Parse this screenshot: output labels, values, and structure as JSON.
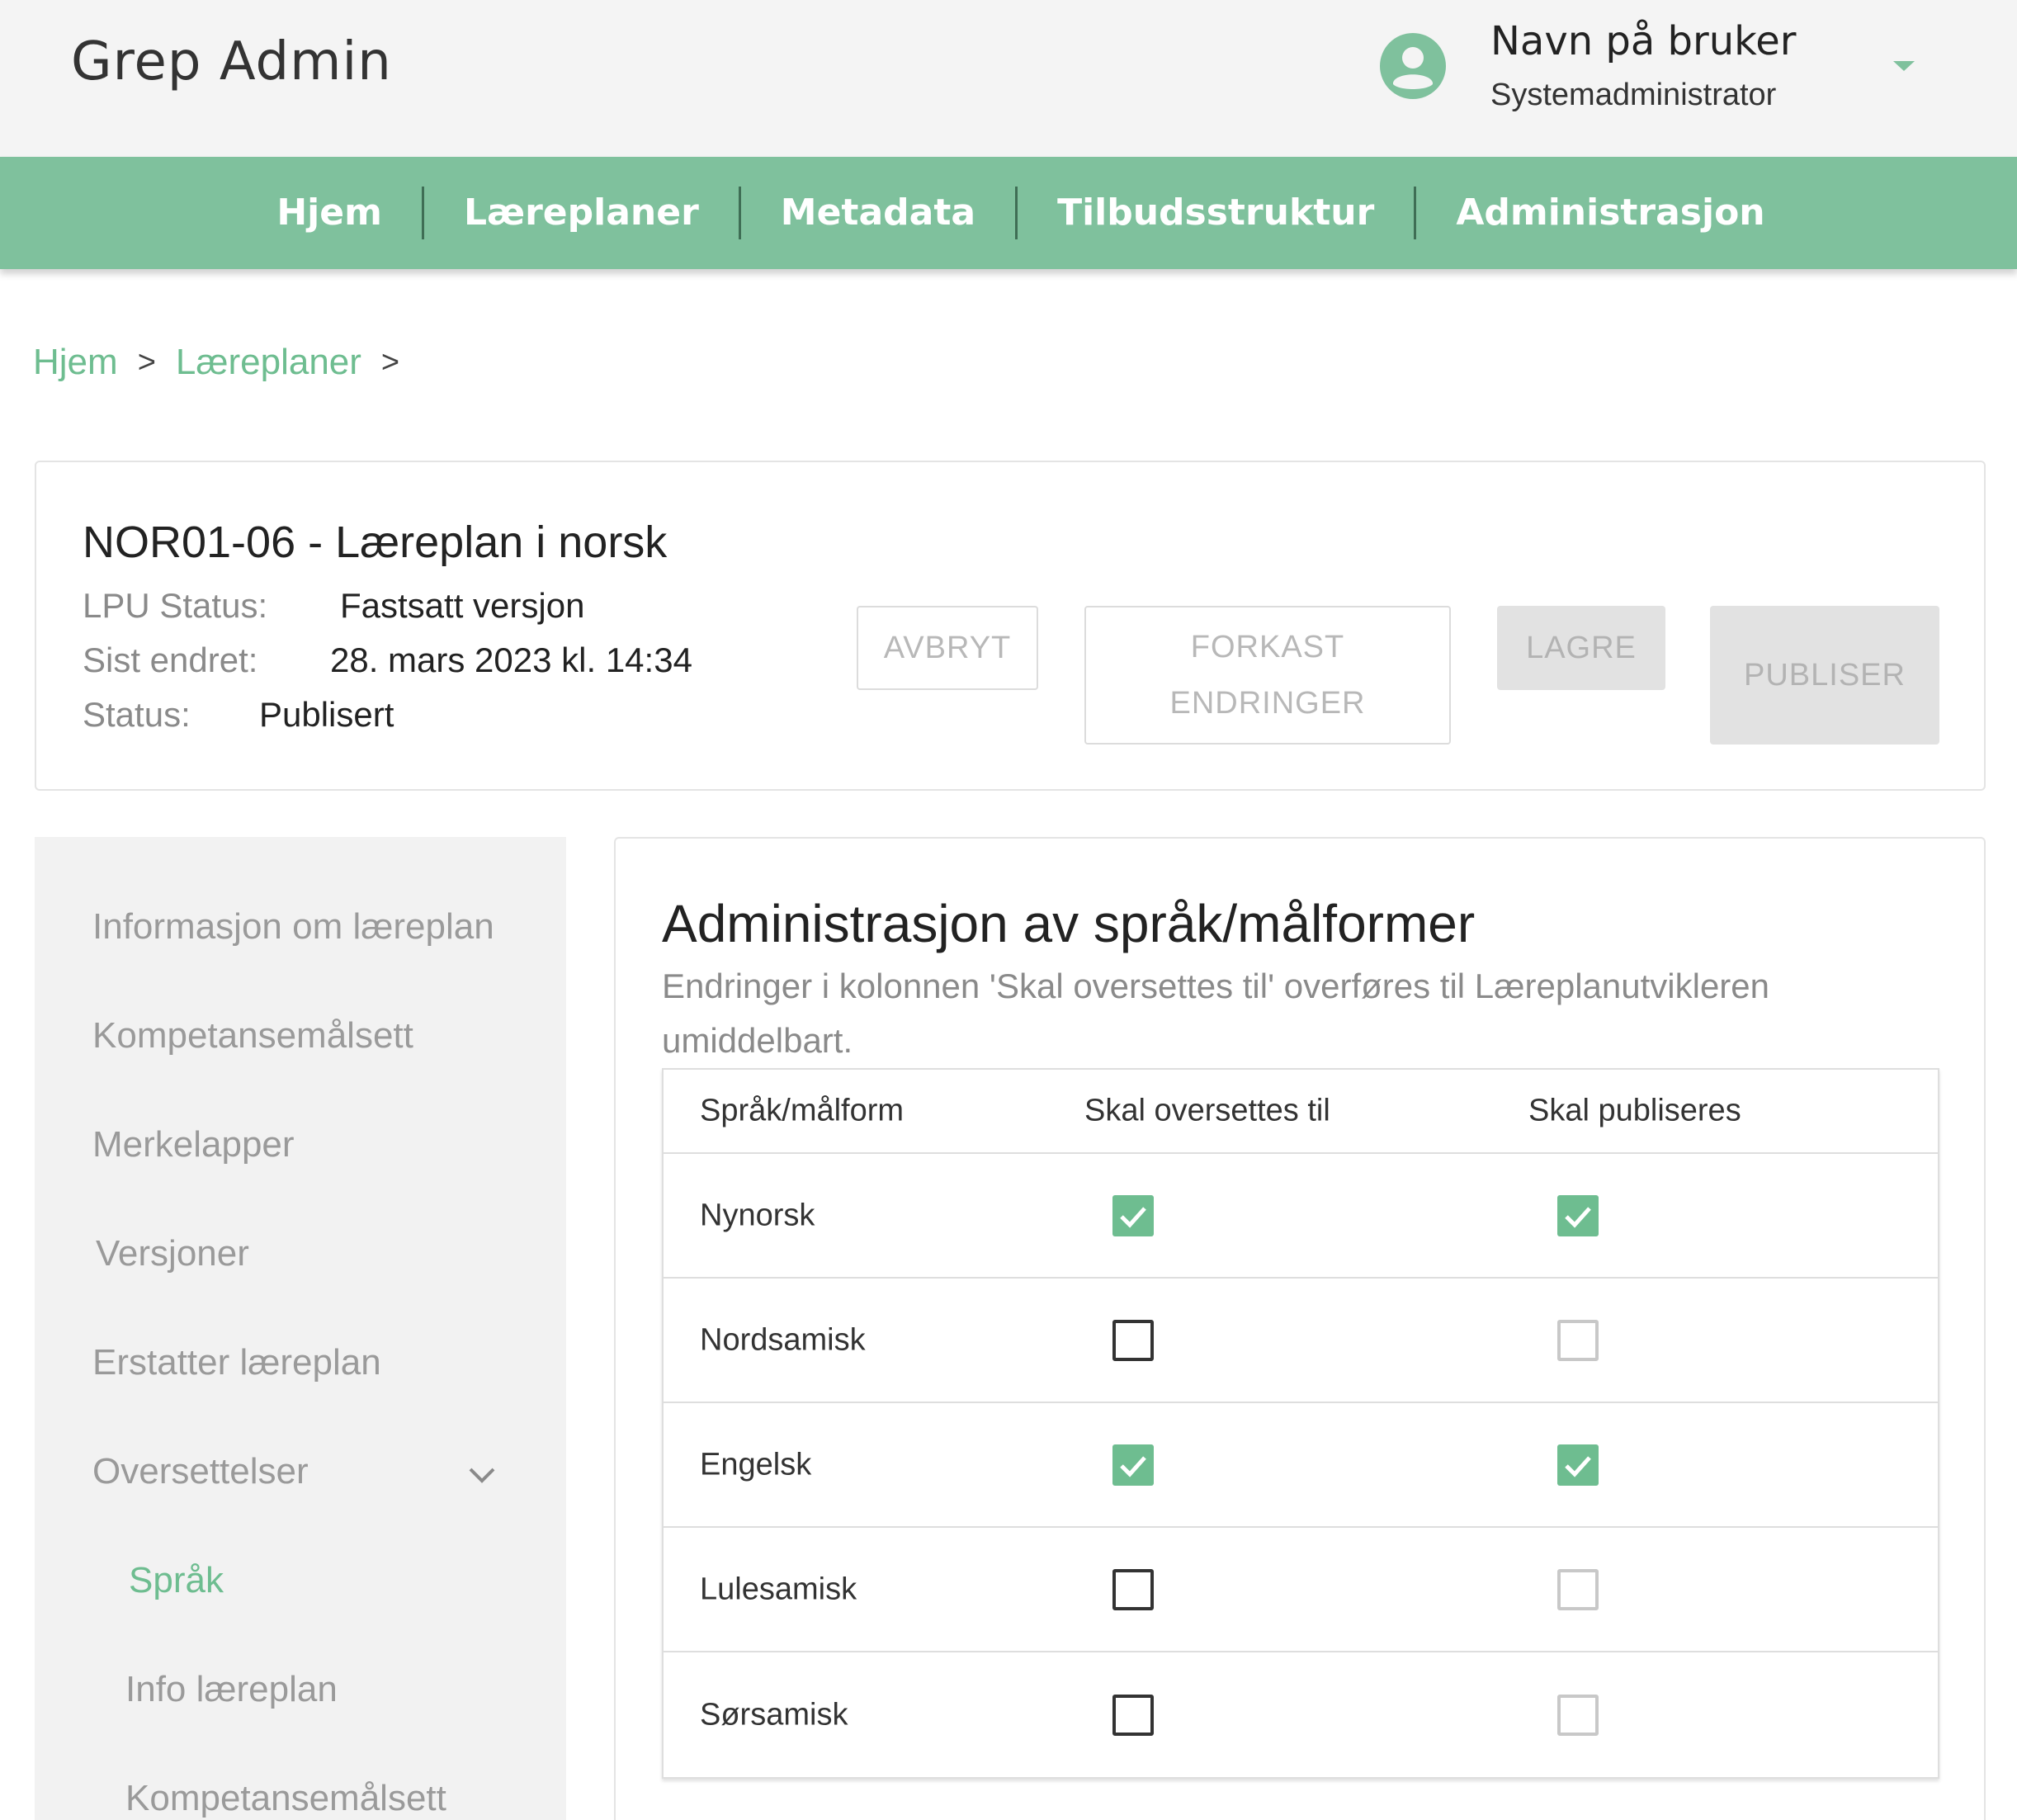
{
  "app": {
    "title": "Grep Admin"
  },
  "user": {
    "name": "Navn på bruker",
    "role": "Systemadministrator"
  },
  "nav": {
    "items": [
      "Hjem",
      "Læreplaner",
      "Metadata",
      "Tilbudsstruktur",
      "Administrasjon"
    ]
  },
  "breadcrumb": {
    "items": [
      "Hjem",
      "Læreplaner"
    ],
    "separator": ">"
  },
  "curriculum": {
    "title": "NOR01-06 - Læreplan i norsk",
    "lpu_status_label": "LPU Status:",
    "lpu_status_value": "Fastsatt versjon",
    "last_changed_label": "Sist endret:",
    "last_changed_value": "28. mars 2023 kl. 14:34",
    "status_label": "Status:",
    "status_value": "Publisert"
  },
  "actions": {
    "cancel": "AVBRYT",
    "discard_line1": "FORKAST",
    "discard_line2": "ENDRINGER",
    "save": "LAGRE",
    "publish": "PUBLISER"
  },
  "sidebar": {
    "items": [
      "Informasjon om læreplan",
      "Kompetansemålsett",
      "Merkelapper",
      "Versjoner",
      "Erstatter læreplan",
      "Oversettelser"
    ],
    "subitems": [
      "Språk",
      "Info læreplan",
      "Kompetansemålsett"
    ],
    "active": "Språk"
  },
  "panel": {
    "title": "Administrasjon av språk/målformer",
    "description": "Endringer i kolonnen 'Skal oversettes til' overføres til Læreplanutvikleren umiddelbart."
  },
  "table": {
    "headers": [
      "Språk/målform",
      "Skal oversettes til",
      "Skal publiseres"
    ],
    "rows": [
      {
        "language": "Nynorsk",
        "translate": true,
        "publish": true
      },
      {
        "language": "Nordsamisk",
        "translate": false,
        "publish": false
      },
      {
        "language": "Engelsk",
        "translate": true,
        "publish": true
      },
      {
        "language": "Lulesamisk",
        "translate": false,
        "publish": false
      },
      {
        "language": "Sørsamisk",
        "translate": false,
        "publish": false
      }
    ]
  },
  "colors": {
    "accent": "#7fc19d",
    "link": "#6ebd90",
    "checked": "#6ebd90",
    "header_bg": "#f4f4f4",
    "sidebar_bg": "#f2f2f2"
  },
  "icons": {
    "avatar": "account-circle-icon",
    "user_menu": "caret-down-icon",
    "sidebar_expand": "chevron-down-icon",
    "checkbox_checked": "check-icon"
  }
}
